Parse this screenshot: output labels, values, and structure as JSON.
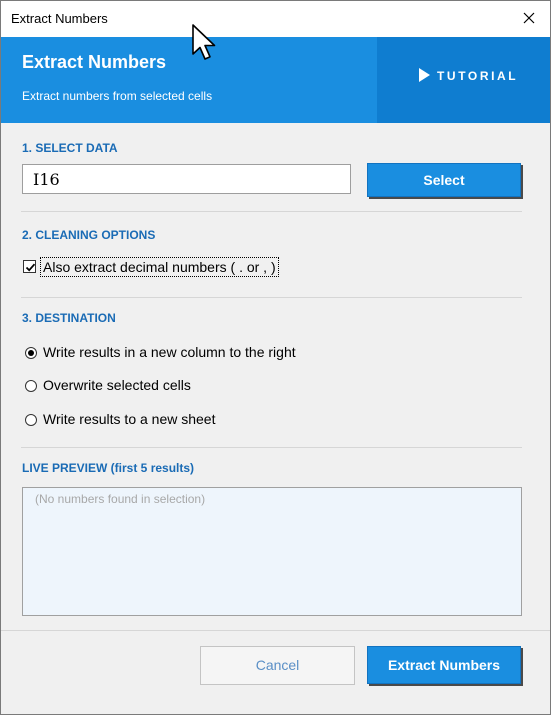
{
  "window": {
    "title": "Extract Numbers"
  },
  "banner": {
    "title": "Extract Numbers",
    "subtitle": "Extract numbers from selected cells",
    "tutorial_label": "TUTORIAL"
  },
  "select_data": {
    "heading": "1. SELECT DATA",
    "range_value": "I16",
    "select_button": "Select"
  },
  "cleaning": {
    "heading": "2. CLEANING OPTIONS",
    "decimal_label": "Also extract decimal numbers  ( . or , )",
    "decimal_checked": true
  },
  "destination": {
    "heading": "3. DESTINATION",
    "options": [
      {
        "label": "Write results in a new column to the right",
        "selected": true
      },
      {
        "label": "Overwrite selected cells",
        "selected": false
      },
      {
        "label": "Write results to a new sheet",
        "selected": false
      }
    ]
  },
  "preview": {
    "heading": "LIVE PREVIEW  (first 5 results)",
    "placeholder": "(No numbers found in selection)"
  },
  "footer": {
    "cancel_label": "Cancel",
    "extract_label": "Extract Numbers"
  },
  "colors": {
    "banner": "#1a8ee0",
    "banner_dark": "#0f7dd0",
    "heading": "#1a6bb5",
    "preview_bg": "#eef5fc"
  },
  "icons": {
    "close": "close-icon",
    "tutorial": "play-icon",
    "checkbox": "checkmark-icon",
    "cursor": "mouse-pointer-icon"
  }
}
